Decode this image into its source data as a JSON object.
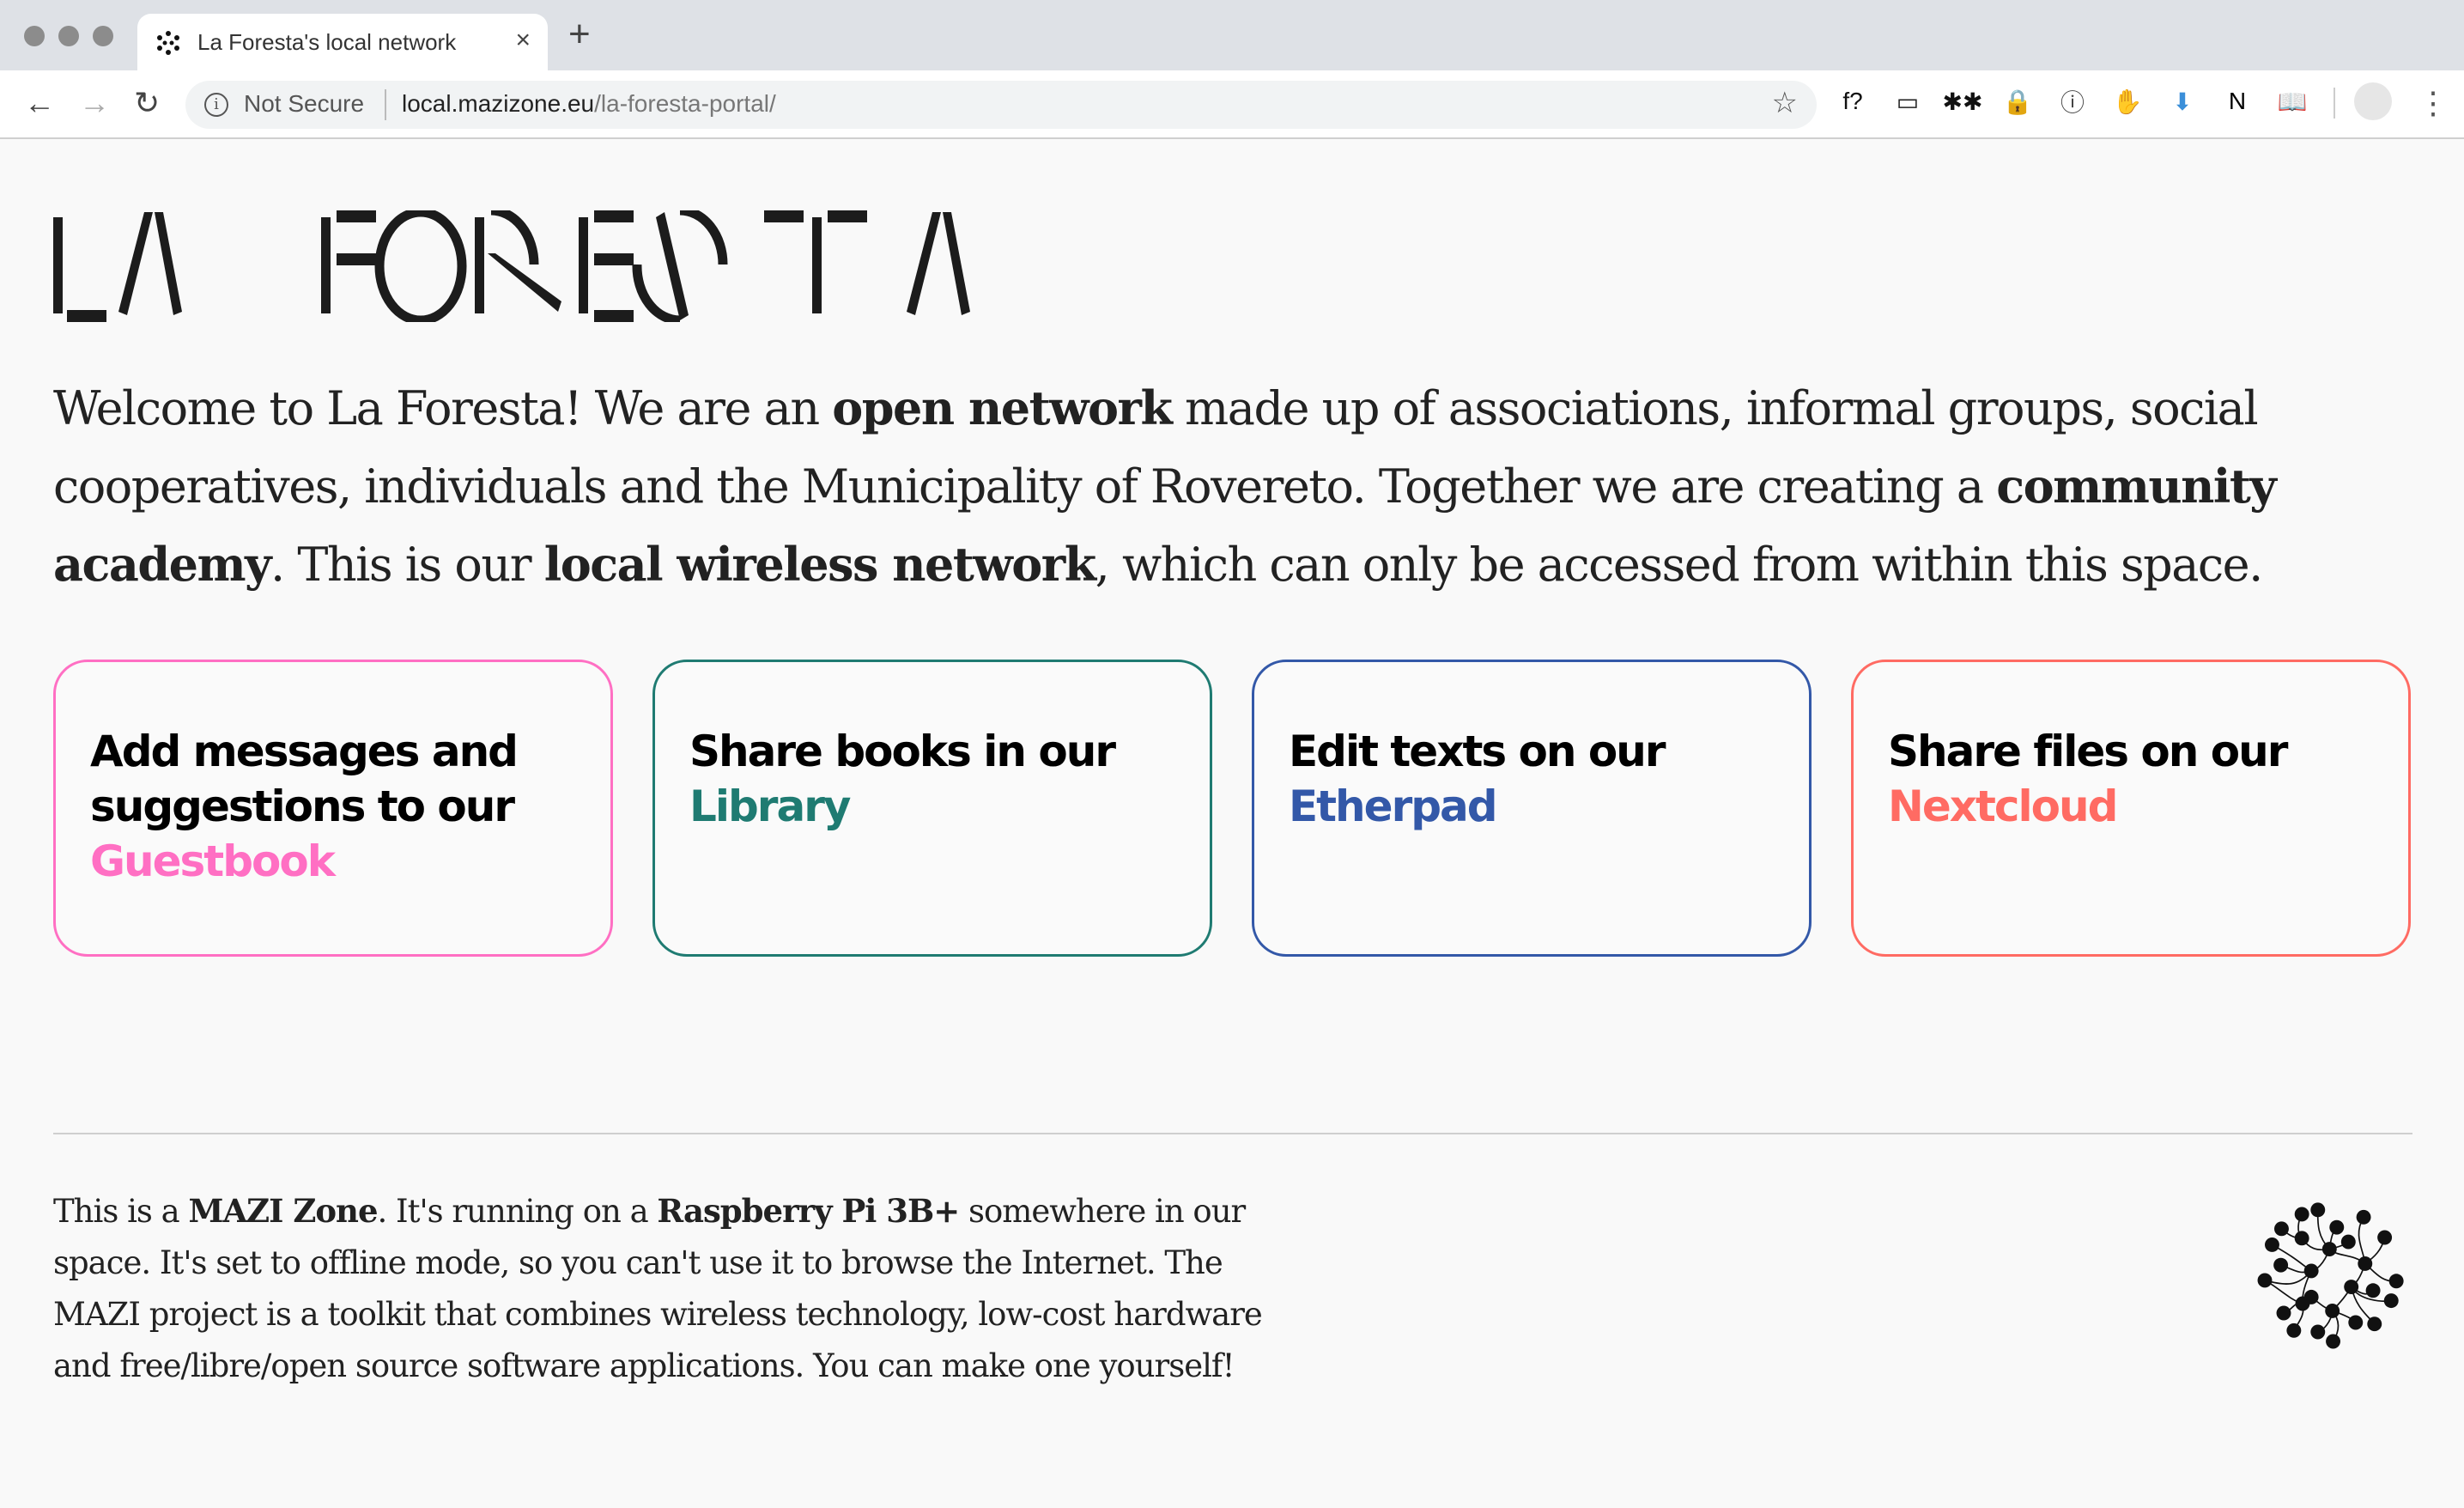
{
  "browser": {
    "tab_title": "La Foresta's local network",
    "tab_close": "×",
    "new_tab": "+",
    "nav": {
      "back": "←",
      "forward": "→",
      "reload": "↻"
    },
    "security_label": "Not Secure",
    "url_host": "local.mazizone.eu",
    "url_path": "/la-foresta-portal/",
    "bookmark_icon": "☆",
    "extensions": [
      {
        "name": "font-identifier-extension-icon",
        "glyph": "f?",
        "color": "#111111"
      },
      {
        "name": "screen-capture-extension-icon",
        "glyph": "▭",
        "color": "#222222"
      },
      {
        "name": "spider-extension-icon",
        "glyph": "✱✱",
        "color": "#111111"
      },
      {
        "name": "lock-extension-icon",
        "glyph": "🔒",
        "color": "#d93025"
      },
      {
        "name": "1password-extension-icon",
        "glyph": "ⓘ",
        "color": "#444444"
      },
      {
        "name": "adblock-extension-icon",
        "glyph": "✋",
        "color": "#e8121c"
      },
      {
        "name": "download-extension-icon",
        "glyph": "⬇",
        "color": "#3b8fd9"
      },
      {
        "name": "notion-extension-icon",
        "glyph": "N",
        "color": "#000000"
      },
      {
        "name": "reader-extension-icon",
        "glyph": "📖",
        "color": "#4a8af4"
      }
    ],
    "menu_icon": "⋮"
  },
  "page": {
    "logo_text": "LA FORESTA",
    "intro": {
      "t1": "Welcome to La Foresta! We are an ",
      "b1": "open network",
      "t2": " made up of associations, informal groups, social cooperatives, individuals and the Municipality of Rovereto. Together we are creating a ",
      "b2": "community academy",
      "t3": ". This is our ",
      "b3": "local wireless network",
      "t4": ", which can only be accessed from within this space."
    },
    "cards": [
      {
        "text": "Add messages and suggestions to our ",
        "link": "Guestbook",
        "color": "#ff6fc3"
      },
      {
        "text": "Share books in our ",
        "link": "Library",
        "color": "#1f7b72"
      },
      {
        "text": "Edit texts on our ",
        "link": "Etherpad",
        "color": "#3358a8"
      },
      {
        "text": "Share files on our ",
        "link": "Nextcloud",
        "color": "#ff6b63"
      }
    ],
    "footer": {
      "t1": "This is a ",
      "b1": "MAZI Zone",
      "t2": ". It's running on a ",
      "b2": "Raspberry Pi 3B+",
      "t3": " somewhere in our space. It's set to offline mode, so you can't use it to browse the Internet. The MAZI project is a toolkit that combines wireless technology, low-cost hardware and free/libre/open source software applications. You can make one yourself!"
    }
  }
}
